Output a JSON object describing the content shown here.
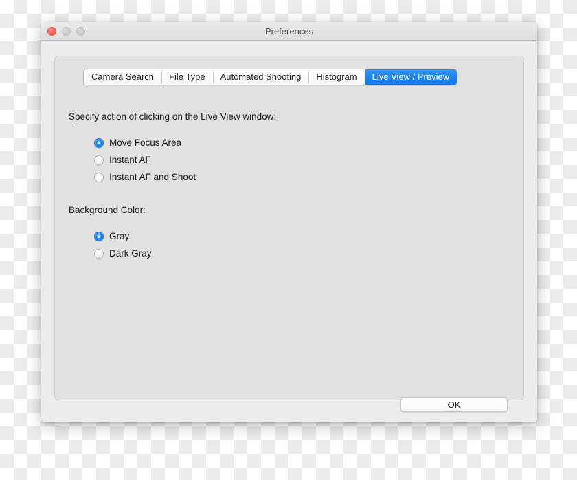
{
  "window": {
    "title": "Preferences",
    "traffic_lights": [
      {
        "name": "close-button",
        "color": "#fc6259"
      },
      {
        "name": "minimize-button",
        "color": "#cdcdcd"
      },
      {
        "name": "maximize-button",
        "color": "#cdcdcd"
      }
    ]
  },
  "tabs": [
    {
      "label": "Camera Search",
      "selected": false
    },
    {
      "label": "File Type",
      "selected": false
    },
    {
      "label": "Automated Shooting",
      "selected": false
    },
    {
      "label": "Histogram",
      "selected": false
    },
    {
      "label": "Live View / Preview",
      "selected": true
    }
  ],
  "groups": [
    {
      "label": "Specify action of clicking on the Live View window:",
      "options": [
        {
          "label": "Move Focus Area",
          "selected": true
        },
        {
          "label": "Instant AF",
          "selected": false
        },
        {
          "label": "Instant AF and Shoot",
          "selected": false
        }
      ]
    },
    {
      "label": "Background Color:",
      "options": [
        {
          "label": "Gray",
          "selected": true
        },
        {
          "label": "Dark Gray",
          "selected": false
        }
      ]
    }
  ],
  "buttons": {
    "ok_label": "OK"
  },
  "colors": {
    "accent_blue": "#2a8cf0",
    "window_bg": "#ececec",
    "panel_bg": "#e1e1e1",
    "text": "#191919",
    "title_text": "#4a4a4a"
  }
}
